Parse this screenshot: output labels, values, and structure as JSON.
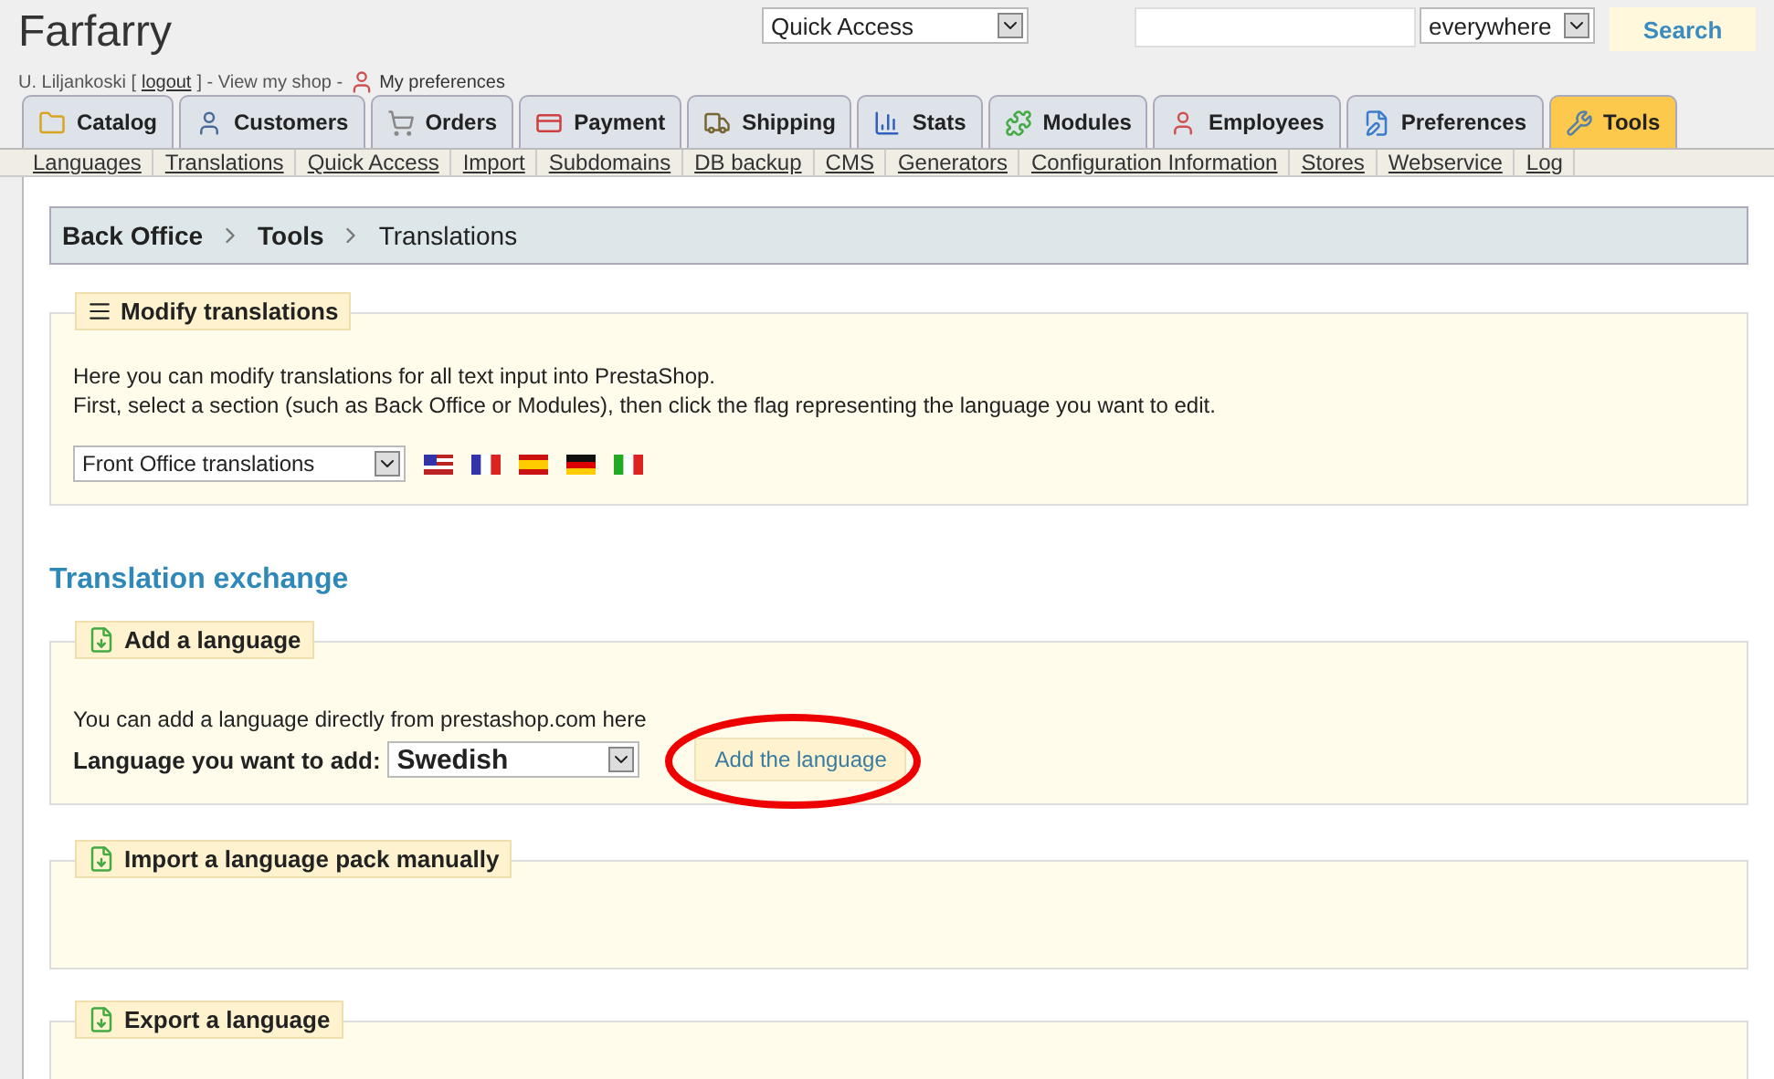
{
  "header": {
    "shop_name": "Farfarry",
    "user": "U. Liljankoski [",
    "logout": "logout",
    "after_logout": "] - View my shop -",
    "preferences": "My preferences",
    "quick_access": {
      "value": "Quick Access"
    },
    "search": {
      "scope": "everywhere",
      "button": "Search"
    }
  },
  "tabs": [
    {
      "label": "Catalog",
      "selected": false
    },
    {
      "label": "Customers",
      "selected": false
    },
    {
      "label": "Orders",
      "selected": false
    },
    {
      "label": "Payment",
      "selected": false
    },
    {
      "label": "Shipping",
      "selected": false
    },
    {
      "label": "Stats",
      "selected": false
    },
    {
      "label": "Modules",
      "selected": false
    },
    {
      "label": "Employees",
      "selected": false
    },
    {
      "label": "Preferences",
      "selected": false
    },
    {
      "label": "Tools",
      "selected": true
    }
  ],
  "subnav": [
    "Languages",
    "Translations",
    "Quick Access",
    "Import",
    "Subdomains",
    "DB backup",
    "CMS",
    "Generators",
    "Configuration Information",
    "Stores",
    "Webservice",
    "Log"
  ],
  "breadcrumb": [
    "Back Office",
    "Tools",
    "Translations"
  ],
  "modify": {
    "title": "Modify translations",
    "lines": [
      "Here you can modify translations for all text input into PrestaShop.",
      "First, select a section (such as Back Office or Modules), then click the flag representing the language you want to edit."
    ],
    "select": "Front Office translations"
  },
  "exchange_heading": "Translation exchange",
  "add": {
    "title": "Add a language",
    "text": "You can add a language directly from prestashop.com here",
    "label": "Language you want to add:",
    "select": "Swedish",
    "button": "Add the language",
    "highlighted": true
  },
  "import": {
    "title": "Import a language pack manually"
  },
  "export": {
    "title": "Export a language"
  }
}
